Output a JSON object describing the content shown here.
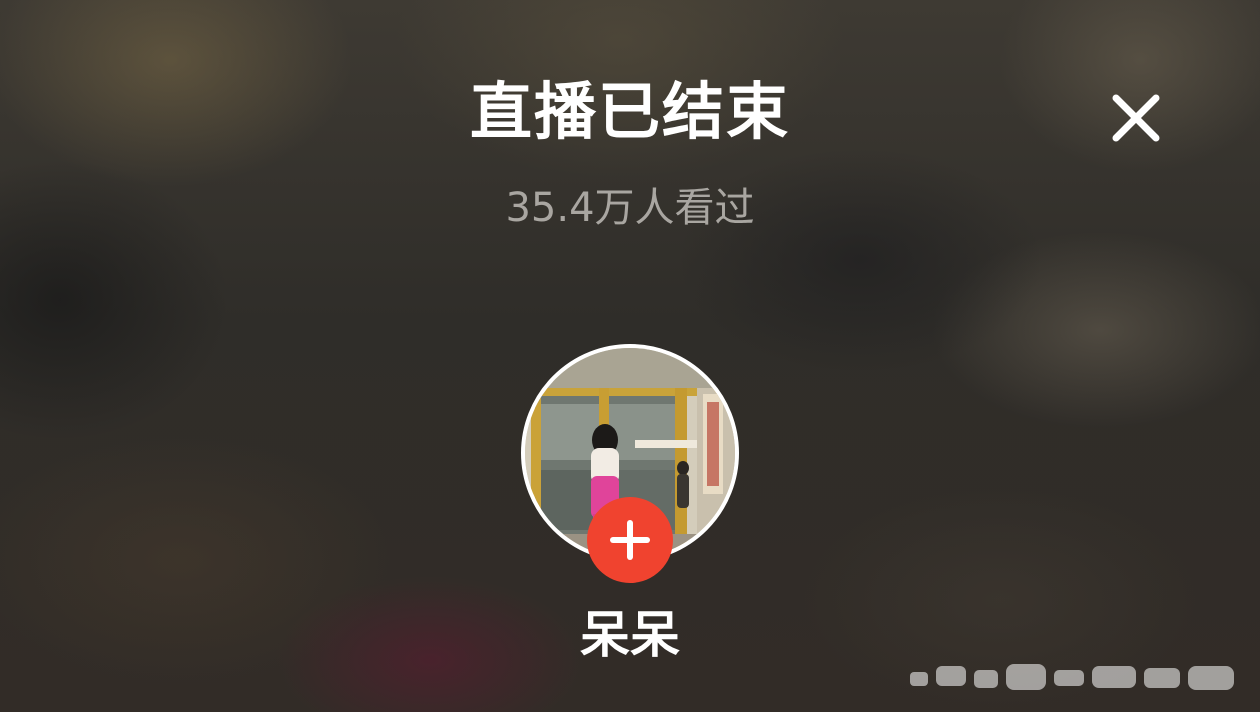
{
  "stream_end": {
    "title": "直播已结束",
    "viewer_count": "35.4万人看过",
    "close_icon": "close-icon"
  },
  "streamer": {
    "name": "呆呆",
    "follow_icon": "plus-icon",
    "follow_color": "#f0432f"
  }
}
